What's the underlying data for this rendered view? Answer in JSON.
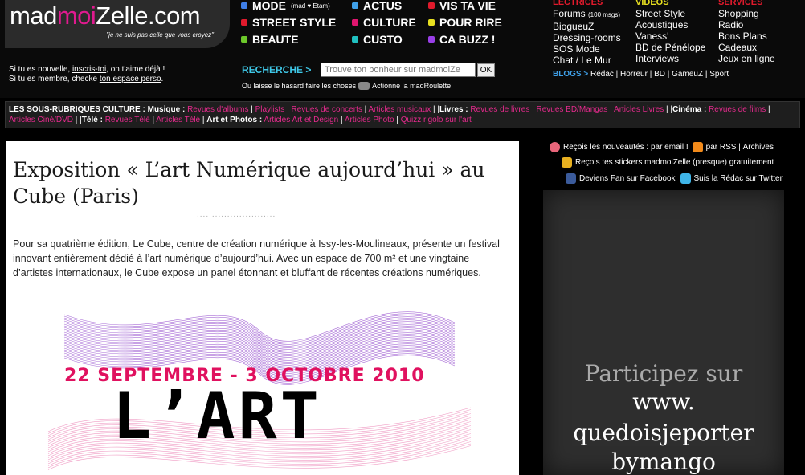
{
  "logo": {
    "prefix": "mad",
    "highlight": "moi",
    "suffix": "Zelle.com",
    "tagline": "\"je ne suis pas celle que vous croyez\""
  },
  "welcome": {
    "line1_pre": "Si tu es nouvelle,",
    "line1_link": "inscris-toi",
    "line1_post": ", on t'aime déjà !",
    "line2_pre": "Si tu es membre, checke",
    "line2_link": "ton espace perso",
    "line2_post": "."
  },
  "nav": [
    {
      "label": "MODE",
      "sub": "(mad ♥ Etam)",
      "color": "#3f7fe8"
    },
    {
      "label": "STREET STYLE",
      "color": "#e01a2c"
    },
    {
      "label": "BEAUTE",
      "color": "#6cc82a"
    },
    {
      "label": "ACTUS",
      "color": "#3fa0e8"
    },
    {
      "label": "CULTURE",
      "color": "#e0156f"
    },
    {
      "label": "CUSTO",
      "color": "#20c0c0"
    },
    {
      "label": "VIS TA VIE",
      "color": "#e01a2c"
    },
    {
      "label": "POUR RIRE",
      "color": "#e8e020"
    },
    {
      "label": "CA BUZZ !",
      "color": "#9a3fe8"
    }
  ],
  "search": {
    "label": "RECHERCHE >",
    "placeholder": "Trouve ton bonheur sur madmoiZe",
    "ok": "OK",
    "roulette_pre": "Ou laisse le hasard faire les choses",
    "roulette_link": "Actionne la madRoulette"
  },
  "columns": {
    "lectrices": {
      "title": "LECTRICES",
      "color": "#e01a2c",
      "items": [
        "Forums",
        "BiogueuZ",
        "Dressing-rooms",
        "SOS Mode",
        "Chat / Le Mur"
      ],
      "forums_note": "(100 msgs)"
    },
    "videos": {
      "title": "VIDEOS",
      "color": "#e8e020",
      "items": [
        "Street Style",
        "Acoustiques",
        "Vaness'",
        "BD de Pénélope",
        "Interviews"
      ]
    },
    "services": {
      "title": "SERVICES",
      "color": "#e01a2c",
      "items": [
        "Shopping",
        "Radio",
        "Bons Plans",
        "Cadeaux",
        "Jeux en ligne"
      ]
    }
  },
  "blogs": {
    "label": "BLOGS >",
    "items": [
      "Rédac",
      "Horreur",
      "BD",
      "GameuZ",
      "Sport"
    ]
  },
  "subbar": {
    "intro": "LES SOUS-RUBRIQUES CULTURE :",
    "musique": "Musique :",
    "musique_items": [
      "Revues d'albums",
      "Playlists",
      "Revues de concerts",
      "Articles musicaux"
    ],
    "livres": "Livres :",
    "livres_items": [
      "Revues de livres",
      "Revues BD/Mangas",
      "Articles Livres"
    ],
    "cinema": "Cinéma :",
    "cinema_items": [
      "Revues de films",
      "Articles Ciné/DVD"
    ],
    "tele": "Télé :",
    "tele_items": [
      "Revues Télé",
      "Articles Télé"
    ],
    "art": "Art et Photos :",
    "art_items": [
      "Articles Art et Design",
      "Articles Photo",
      "Quizz rigolo sur l'art"
    ]
  },
  "article": {
    "title": "Exposition « L’art Numérique aujourd’hui » au Cube (Paris)",
    "dots": "..........................",
    "lead": "Pour sa quatrième édition, Le Cube, centre de création numérique à Issy-les-Moulineaux, présente un festival innovant entièrement dédié à l’art numérique d’aujourd’hui. Avec un espace de 700 m² et une vingtaine d’artistes internationaux, le Cube expose un panel étonnant et bluffant de récentes créations numériques.",
    "poster_dates": "22 SEPTEMBRE - 3 OCTOBRE 2010",
    "poster_big": "L’ART"
  },
  "sidebar": {
    "newsletter": "Reçois les nouveautés : par email !",
    "rss": "par RSS",
    "archives": "Archives",
    "stickers": "Reçois tes stickers madmoiZelle (presque) gratuitement",
    "facebook": "Deviens Fan sur Facebook",
    "twitter": "Suis la Rédac sur Twitter",
    "ad_lines": [
      "Participez sur",
      "www.",
      "quedoisjeporter",
      "bymango"
    ]
  }
}
